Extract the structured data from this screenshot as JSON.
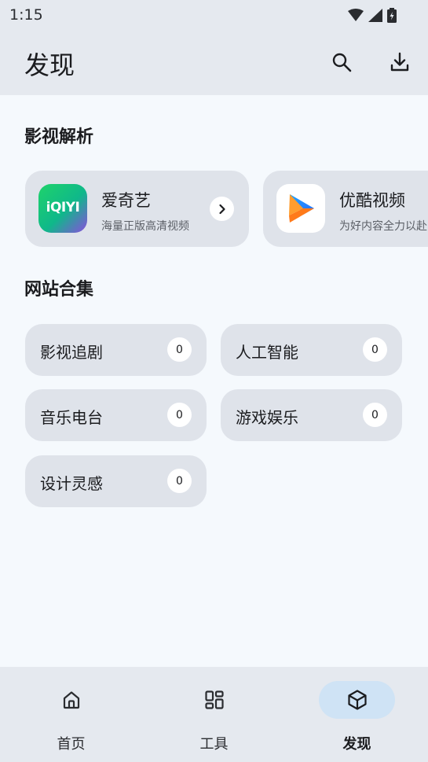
{
  "status": {
    "time": "1:15"
  },
  "appbar": {
    "title": "发现"
  },
  "sections": {
    "video_parse": "影视解析",
    "site_collection": "网站合集"
  },
  "apps": [
    {
      "name": "爱奇艺",
      "desc": "海量正版高清视频",
      "logo_text": "iQIYI",
      "icon": "iqiyi-logo"
    },
    {
      "name": "优酷视频",
      "desc": "为好内容全力以赴",
      "icon": "youku-logo"
    }
  ],
  "categories": [
    {
      "label": "影视追剧",
      "count": "0"
    },
    {
      "label": "人工智能",
      "count": "0"
    },
    {
      "label": "音乐电台",
      "count": "0"
    },
    {
      "label": "游戏娱乐",
      "count": "0"
    },
    {
      "label": "设计灵感",
      "count": "0"
    }
  ],
  "nav": [
    {
      "label": "首页",
      "icon": "home-icon"
    },
    {
      "label": "工具",
      "icon": "grid-icon"
    },
    {
      "label": "发现",
      "icon": "cube-icon",
      "active": true
    }
  ],
  "colors": {
    "surface": "#e5e9ef",
    "card": "#dfe3ea",
    "background": "#f5f9fd",
    "active_indicator": "#cfe3f5"
  }
}
